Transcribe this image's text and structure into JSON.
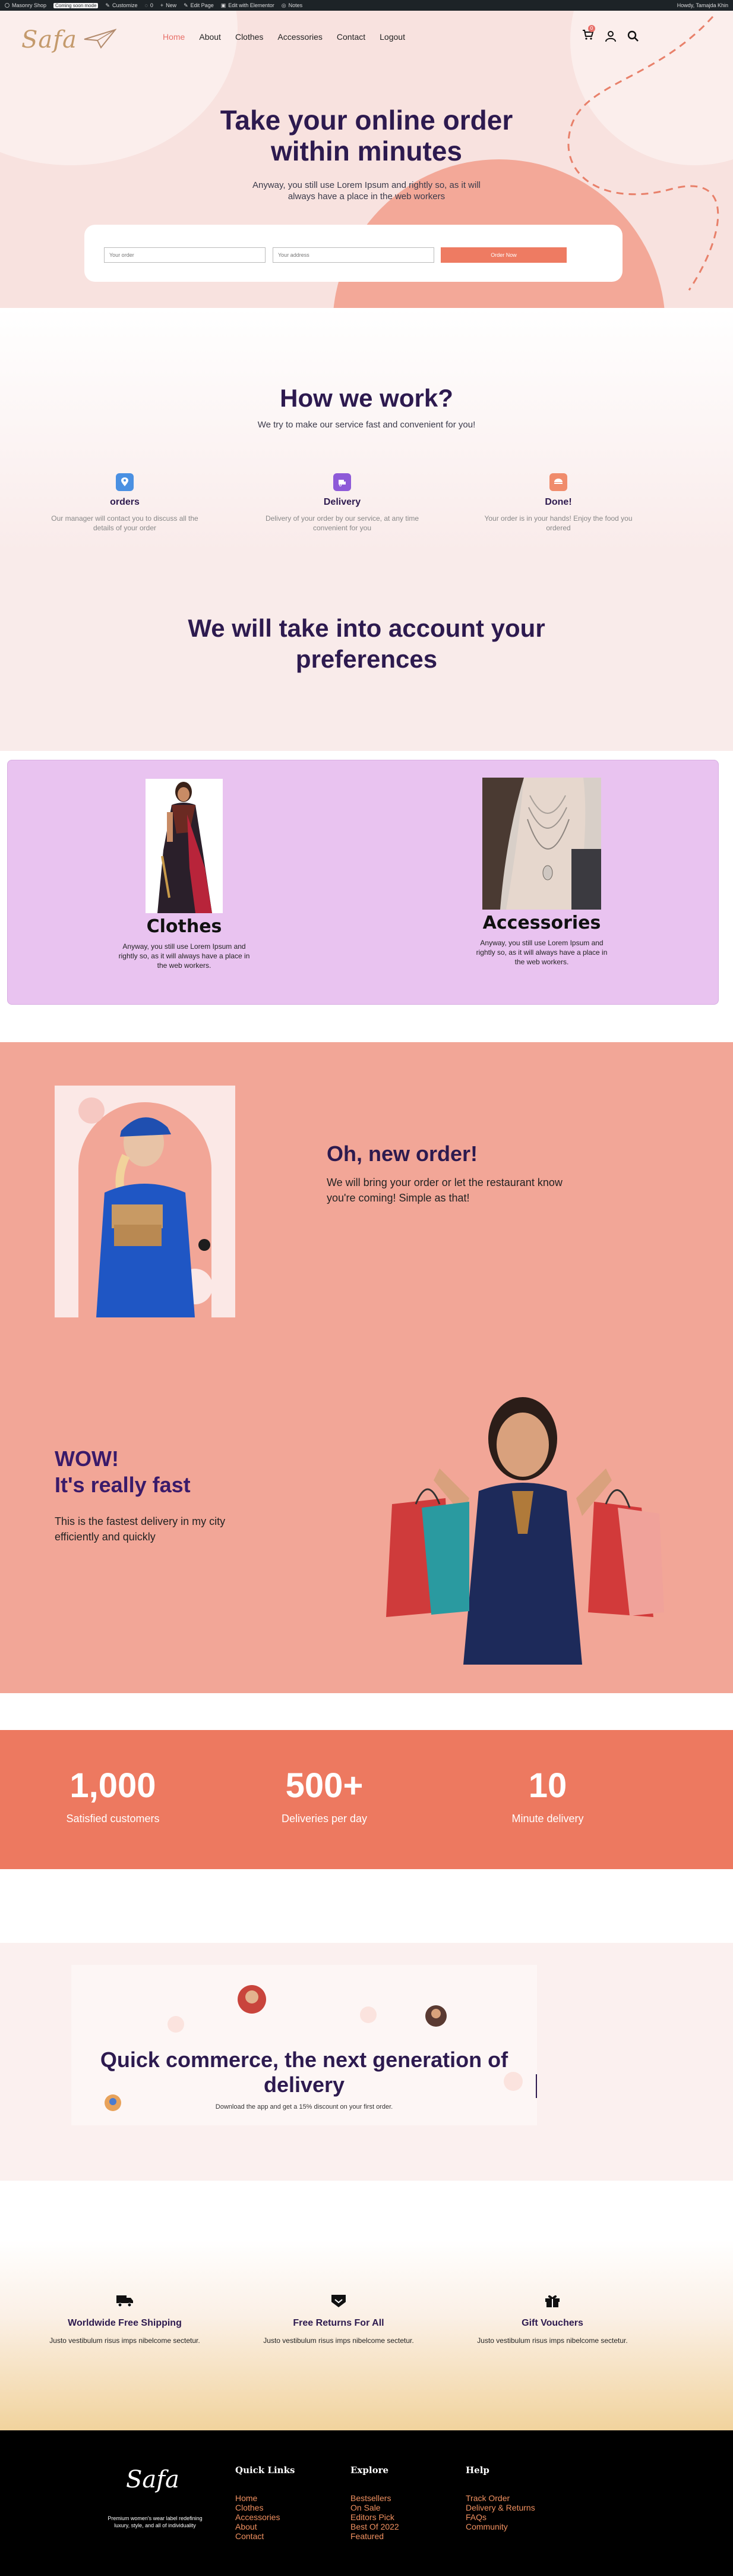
{
  "admin_bar": {
    "items": [
      "Masonry Shop",
      "Customize",
      "0",
      "New",
      "Edit Page",
      "Edit with Elementor",
      "Notes"
    ],
    "badge": "Coming soon mode",
    "right": "Howdy, Tamajda Khin"
  },
  "nav": {
    "logo": "Safa",
    "links": [
      "Home",
      "About",
      "Clothes",
      "Accessories",
      "Contact",
      "Logout"
    ],
    "active": "Home",
    "cart_count": "0"
  },
  "hero": {
    "title": "Take your online order within minutes",
    "subtitle": "Anyway, you still use Lorem Ipsum and rightly so, as it will always have a place in the web workers",
    "order_placeholder": "Your order",
    "address_placeholder": "Your address",
    "button": "Order Now"
  },
  "floating_cart": {
    "count": "0"
  },
  "how": {
    "title": "How we work?",
    "subtitle": "We try to make our service fast and convenient for you!",
    "steps": [
      {
        "title": "orders",
        "text": "Our manager will contact you to discuss all the details of your order",
        "icon": "location-pin-icon",
        "color": "#4a90e2"
      },
      {
        "title": "Delivery",
        "text": "Delivery of your order by our service, at any time convenient for you",
        "icon": "delivery-icon",
        "color": "#8e5ad8"
      },
      {
        "title": "Done!",
        "text": "Your order is in your hands! Enjoy the food you ordered",
        "icon": "done-icon",
        "color": "#f08c6c"
      }
    ],
    "preferences_title": "We will take into account your preferences"
  },
  "categories": [
    {
      "name": "Clothes",
      "text": "Anyway, you still use Lorem Ipsum and rightly so, as it will always have a place in the web workers."
    },
    {
      "name": "Accessories",
      "text": "Anyway, you still use Lorem Ipsum and rightly so, as it will always have a place in the web workers."
    }
  ],
  "promo": {
    "order_title": "Oh, new order!",
    "order_text": "We will bring your order or let the restaurant know you're coming! Simple as that!",
    "wow_title_1": "WOW!",
    "wow_title_2": "It's really fast",
    "wow_text": "This is the fastest delivery in my city efficiently and quickly"
  },
  "stats": [
    {
      "value": "1,000",
      "label": "Satisfied customers"
    },
    {
      "value": "500+",
      "label": "Deliveries per day"
    },
    {
      "value": "10",
      "label": "Minute delivery"
    }
  ],
  "quick_commerce": {
    "title": "Quick commerce, the next generation of delivery",
    "subtitle": "Download the app and get a 15% discount on your first order."
  },
  "features": [
    {
      "title": "Worldwide Free Shipping",
      "text": "Justo vestibulum risus imps nibelcome sectetur.",
      "icon": "truck-icon"
    },
    {
      "title": "Free Returns For All",
      "text": "Justo vestibulum risus imps nibelcome sectetur.",
      "icon": "return-icon"
    },
    {
      "title": "Gift Vouchers",
      "text": "Justo vestibulum risus imps nibelcome sectetur.",
      "icon": "gift-icon"
    }
  ],
  "footer": {
    "logo": "Safa",
    "tagline": "Premium women's wear label redefining luxury, style, and all of individuality",
    "quick_links_title": "Quick Links",
    "quick_links": [
      "Home",
      "Clothes",
      "Accessories",
      "About",
      "Contact"
    ],
    "explore_title": "Explore",
    "explore": [
      "Bestsellers",
      "On Sale",
      "Editors Pick",
      "Best Of 2022",
      "Featured"
    ],
    "help_title": "Help",
    "help": [
      "Track Order",
      "Delivery & Returns",
      "FAQs",
      "Community"
    ]
  },
  "colors": {
    "accent": "#ee7b62",
    "heading": "#2d1a4f",
    "hero_bg": "#f8e2df",
    "category_panel": "#e9c3f0",
    "salmon": "#f2a697",
    "stats_bg": "#ed7960"
  }
}
